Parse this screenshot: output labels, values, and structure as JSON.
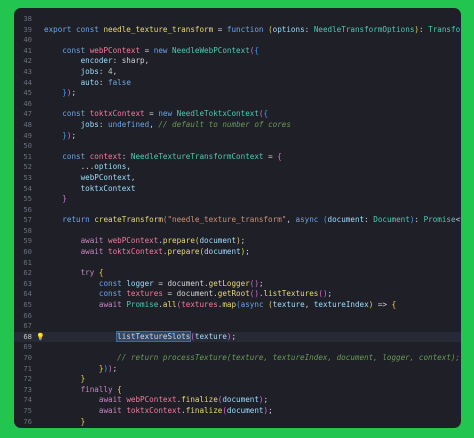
{
  "editor": {
    "lines": [
      {
        "n": "38",
        "tokens": []
      },
      {
        "n": "39",
        "tokens": [
          [
            "kw",
            "export "
          ],
          [
            "kw",
            "const "
          ],
          [
            "fn",
            "needle_texture_transform"
          ],
          [
            "pu",
            " = "
          ],
          [
            "kw",
            "function "
          ],
          [
            "b1",
            "("
          ],
          [
            "va",
            "options"
          ],
          [
            "pu",
            ": "
          ],
          [
            "ty",
            "NeedleTransformOptions"
          ],
          [
            "b1",
            ")"
          ],
          [
            "pu",
            ": "
          ],
          [
            "ty",
            "Transform "
          ],
          [
            "b1",
            "{"
          ]
        ]
      },
      {
        "n": "40",
        "tokens": []
      },
      {
        "n": "41",
        "tokens": [
          [
            "pu",
            "    "
          ],
          [
            "kw",
            "const "
          ],
          [
            "vr",
            "webPContext"
          ],
          [
            "pu",
            " = "
          ],
          [
            "kw",
            "new "
          ],
          [
            "ty",
            "NeedleWebPContext"
          ],
          [
            "b2",
            "("
          ],
          [
            "b3",
            "{"
          ]
        ]
      },
      {
        "n": "42",
        "tokens": [
          [
            "pu",
            "        "
          ],
          [
            "va",
            "encoder"
          ],
          [
            "pu",
            ": sharp,"
          ]
        ]
      },
      {
        "n": "43",
        "tokens": [
          [
            "pu",
            "        "
          ],
          [
            "va",
            "jobs"
          ],
          [
            "pu",
            ": "
          ],
          [
            "nm",
            "4"
          ],
          [
            "pu",
            ","
          ]
        ]
      },
      {
        "n": "44",
        "tokens": [
          [
            "pu",
            "        "
          ],
          [
            "va",
            "auto"
          ],
          [
            "pu",
            ": "
          ],
          [
            "kw",
            "false"
          ]
        ]
      },
      {
        "n": "45",
        "tokens": [
          [
            "pu",
            "    "
          ],
          [
            "b3",
            "}"
          ],
          [
            "b2",
            ")"
          ],
          [
            "pu",
            ";"
          ]
        ]
      },
      {
        "n": "46",
        "tokens": []
      },
      {
        "n": "47",
        "tokens": [
          [
            "pu",
            "    "
          ],
          [
            "kw",
            "const "
          ],
          [
            "vr",
            "toktxContext"
          ],
          [
            "pu",
            " = "
          ],
          [
            "kw",
            "new "
          ],
          [
            "ty",
            "NeedleToktxContext"
          ],
          [
            "b2",
            "("
          ],
          [
            "b3",
            "{"
          ]
        ]
      },
      {
        "n": "48",
        "tokens": [
          [
            "pu",
            "        "
          ],
          [
            "va",
            "jobs"
          ],
          [
            "pu",
            ": "
          ],
          [
            "kw",
            "undefined"
          ],
          [
            "pu",
            ", "
          ],
          [
            "cm",
            "// default to number of cores"
          ]
        ]
      },
      {
        "n": "49",
        "tokens": [
          [
            "pu",
            "    "
          ],
          [
            "b3",
            "}"
          ],
          [
            "b2",
            ")"
          ],
          [
            "pu",
            ";"
          ]
        ]
      },
      {
        "n": "50",
        "tokens": []
      },
      {
        "n": "51",
        "tokens": [
          [
            "pu",
            "    "
          ],
          [
            "kw",
            "const "
          ],
          [
            "vr",
            "context"
          ],
          [
            "pu",
            ": "
          ],
          [
            "ty",
            "NeedleTextureTransformContext"
          ],
          [
            "pu",
            " = "
          ],
          [
            "b2",
            "{"
          ]
        ]
      },
      {
        "n": "52",
        "tokens": [
          [
            "pu",
            "        ..."
          ],
          [
            "va",
            "options"
          ],
          [
            "pu",
            ","
          ]
        ]
      },
      {
        "n": "53",
        "tokens": [
          [
            "pu",
            "        "
          ],
          [
            "va",
            "webPContext"
          ],
          [
            "pu",
            ","
          ]
        ]
      },
      {
        "n": "54",
        "tokens": [
          [
            "pu",
            "        "
          ],
          [
            "va",
            "toktxContext"
          ]
        ]
      },
      {
        "n": "55",
        "tokens": [
          [
            "pu",
            "    "
          ],
          [
            "b2",
            "}"
          ]
        ]
      },
      {
        "n": "56",
        "tokens": []
      },
      {
        "n": "57",
        "tokens": [
          [
            "pu",
            "    "
          ],
          [
            "kw",
            "return "
          ],
          [
            "fn",
            "createTransform"
          ],
          [
            "b2",
            "("
          ],
          [
            "st",
            "\"needle_texture_transform\""
          ],
          [
            "pu",
            ", "
          ],
          [
            "kw",
            "async "
          ],
          [
            "b3",
            "("
          ],
          [
            "va",
            "document"
          ],
          [
            "pu",
            ": "
          ],
          [
            "ty",
            "Document"
          ],
          [
            "b3",
            ")"
          ],
          [
            "pu",
            ": "
          ],
          [
            "ty",
            "Promise"
          ],
          [
            "pu",
            "<"
          ],
          [
            "kw",
            "void"
          ],
          [
            "pu",
            "> => "
          ],
          [
            "b3",
            "{"
          ]
        ]
      },
      {
        "n": "58",
        "tokens": []
      },
      {
        "n": "59",
        "tokens": [
          [
            "pu",
            "        "
          ],
          [
            "kw2",
            "await "
          ],
          [
            "vr",
            "webPContext"
          ],
          [
            "pu",
            "."
          ],
          [
            "fn",
            "prepare"
          ],
          [
            "b1",
            "("
          ],
          [
            "va",
            "document"
          ],
          [
            "b1",
            ")"
          ],
          [
            "pu",
            ";"
          ]
        ]
      },
      {
        "n": "60",
        "tokens": [
          [
            "pu",
            "        "
          ],
          [
            "kw2",
            "await "
          ],
          [
            "vr",
            "toktxContext"
          ],
          [
            "pu",
            "."
          ],
          [
            "fn",
            "prepare"
          ],
          [
            "b1",
            "("
          ],
          [
            "va",
            "document"
          ],
          [
            "b1",
            ")"
          ],
          [
            "pu",
            ";"
          ]
        ]
      },
      {
        "n": "61",
        "tokens": []
      },
      {
        "n": "62",
        "tokens": [
          [
            "pu",
            "        "
          ],
          [
            "kw2",
            "try "
          ],
          [
            "b1",
            "{"
          ]
        ]
      },
      {
        "n": "63",
        "tokens": [
          [
            "pu",
            "            "
          ],
          [
            "kw",
            "const "
          ],
          [
            "va",
            "logger"
          ],
          [
            "pu",
            " = document."
          ],
          [
            "fn",
            "getLogger"
          ],
          [
            "b2",
            "()"
          ],
          [
            "pu",
            ";"
          ]
        ]
      },
      {
        "n": "64",
        "tokens": [
          [
            "pu",
            "            "
          ],
          [
            "kw",
            "const "
          ],
          [
            "vr",
            "textures"
          ],
          [
            "pu",
            " = document."
          ],
          [
            "fn",
            "getRoot"
          ],
          [
            "b2",
            "()"
          ],
          [
            "pu",
            "."
          ],
          [
            "fn",
            "listTextures"
          ],
          [
            "b2",
            "()"
          ],
          [
            "pu",
            ";"
          ]
        ]
      },
      {
        "n": "65",
        "tokens": [
          [
            "pu",
            "            "
          ],
          [
            "kw2",
            "await "
          ],
          [
            "ty",
            "Promise"
          ],
          [
            "pu",
            "."
          ],
          [
            "fn",
            "all"
          ],
          [
            "b2",
            "("
          ],
          [
            "vr",
            "textures"
          ],
          [
            "pu",
            "."
          ],
          [
            "fn",
            "map"
          ],
          [
            "b3",
            "("
          ],
          [
            "kw",
            "async "
          ],
          [
            "b1",
            "("
          ],
          [
            "va",
            "texture"
          ],
          [
            "pu",
            ", "
          ],
          [
            "va",
            "textureIndex"
          ],
          [
            "b1",
            ")"
          ],
          [
            "pu",
            " => "
          ],
          [
            "b1",
            "{"
          ]
        ]
      },
      {
        "n": "66",
        "tokens": []
      },
      {
        "n": "67",
        "tokens": []
      },
      {
        "n": "68",
        "active": true,
        "tokens": [
          [
            "pu",
            "                "
          ],
          [
            "hl",
            "listTextureSlots"
          ],
          [
            "b2",
            "("
          ],
          [
            "va",
            "texture"
          ],
          [
            "b2",
            ")"
          ],
          [
            "pu",
            ";"
          ]
        ]
      },
      {
        "n": "69",
        "tokens": []
      },
      {
        "n": "70",
        "tokens": [
          [
            "pu",
            "                "
          ],
          [
            "cm",
            "// return processTexture(texture, textureIndex, document, logger, context);"
          ]
        ]
      },
      {
        "n": "71",
        "tokens": [
          [
            "pu",
            "            "
          ],
          [
            "b1",
            "}"
          ],
          [
            "b3",
            ")"
          ],
          [
            "b2",
            ")"
          ],
          [
            "pu",
            ";"
          ]
        ]
      },
      {
        "n": "72",
        "tokens": [
          [
            "pu",
            "        "
          ],
          [
            "b1",
            "}"
          ]
        ]
      },
      {
        "n": "73",
        "tokens": [
          [
            "pu",
            "        "
          ],
          [
            "kw2",
            "finally "
          ],
          [
            "b1",
            "{"
          ]
        ]
      },
      {
        "n": "74",
        "tokens": [
          [
            "pu",
            "            "
          ],
          [
            "kw2",
            "await "
          ],
          [
            "vr",
            "webPContext"
          ],
          [
            "pu",
            "."
          ],
          [
            "fn",
            "finalize"
          ],
          [
            "b2",
            "("
          ],
          [
            "va",
            "document"
          ],
          [
            "b2",
            ")"
          ],
          [
            "pu",
            ";"
          ]
        ]
      },
      {
        "n": "75",
        "tokens": [
          [
            "pu",
            "            "
          ],
          [
            "kw2",
            "await "
          ],
          [
            "vr",
            "toktxContext"
          ],
          [
            "pu",
            "."
          ],
          [
            "fn",
            "finalize"
          ],
          [
            "b2",
            "("
          ],
          [
            "va",
            "document"
          ],
          [
            "b2",
            ")"
          ],
          [
            "pu",
            ";"
          ]
        ]
      },
      {
        "n": "76",
        "tokens": [
          [
            "pu",
            "        "
          ],
          [
            "b1",
            "}"
          ]
        ]
      },
      {
        "n": "77",
        "tokens": [
          [
            "pu",
            "    "
          ],
          [
            "b3",
            "}"
          ],
          [
            "b2",
            ")"
          ]
        ]
      },
      {
        "n": "78",
        "tokens": [
          [
            "b1",
            "}"
          ]
        ]
      },
      {
        "n": "79",
        "tokens": []
      }
    ]
  },
  "gutter": {
    "active_line": "68",
    "lightbulb_icon": "lightbulb-icon"
  },
  "theme": {
    "background": "#23c551",
    "editor_background": "#1e1f27",
    "active_line_background": "#272934"
  }
}
